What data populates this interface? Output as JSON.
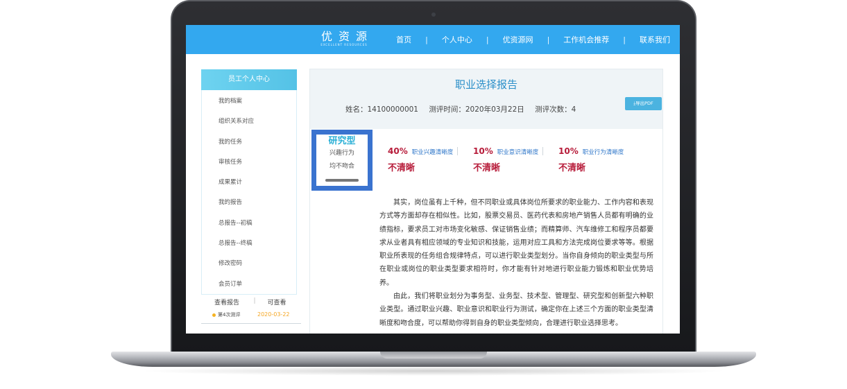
{
  "brand": {
    "name": "优资源",
    "tagline": "EXCELLENT RESOURCES"
  },
  "nav": {
    "items": [
      "首页",
      "个人中心",
      "优资源网",
      "工作机会推荐",
      "联系我们"
    ],
    "separator": "|"
  },
  "sidebar": {
    "title": "员工个人中心",
    "items": [
      "我的档案",
      "组织关系对应",
      "我的任务",
      "审核任务",
      "成果累计",
      "我的报告",
      "总报告--初稿",
      "总报告--终稿",
      "修改密码",
      "会员订单"
    ],
    "report_row": {
      "left": "查看报告",
      "separator": "|",
      "right": "可查看"
    },
    "attempt": {
      "label": "第4次测评",
      "date": "2020-03-22"
    }
  },
  "report": {
    "title": "职业选择报告",
    "name_label": "姓名：",
    "name_value": "14100000001",
    "time_label": "测评时间：",
    "time_value": "2020年03月22日",
    "count_label": "测评次数：",
    "count_value": "4",
    "export_label": "导出PDF",
    "type_card": {
      "type": "研究型",
      "line1": "兴趣行为",
      "line2": "均不吻合"
    },
    "metrics": [
      {
        "percent": "40%",
        "name": "职业兴趣清晰度",
        "status": "不清晰"
      },
      {
        "percent": "10%",
        "name": "职业意识清晰度",
        "status": "不清晰"
      },
      {
        "percent": "10%",
        "name": "职业行为清晰度",
        "status": "不清晰"
      }
    ],
    "paragraphs": [
      "其实，岗位虽有上千种，但不同职业或具体岗位所要求的职业能力、工作内容和表现方式等方面却存在相似性。比如，股票交易员、医药代表和房地产销售人员都有明确的业绩指标，要求员工对市场变化敏感、保证销售业绩；而精算师、汽车维修工和程序员都要求从业者具有相应领域的专业知识和技能，运用对应工具和方法完成岗位要求等等。根据职业所表现的任务组合规律特点，可以进行职业类型划分。当你自身倾向的职业类型与所在职业或岗位的职业类型要求相符时，你才能有针对地进行职业能力锻炼和职业优势培养。",
      "由此，我们将职业划分为事务型、业务型、技术型、管理型、研究型和创新型六种职业类型。通过职业兴趣、职业意识和职业行为测试，确定你在上述三个方面的职业类型清晰度和吻合度，可以帮助你得到自身的职业类型倾向，合理进行职业选择思考。"
    ]
  },
  "colors": {
    "topbar": "#33a8ef",
    "title": "#2b8fc9",
    "status": "#b71c3a",
    "metric_name": "#2b74c8",
    "type_card_border": "#3a73cf"
  }
}
